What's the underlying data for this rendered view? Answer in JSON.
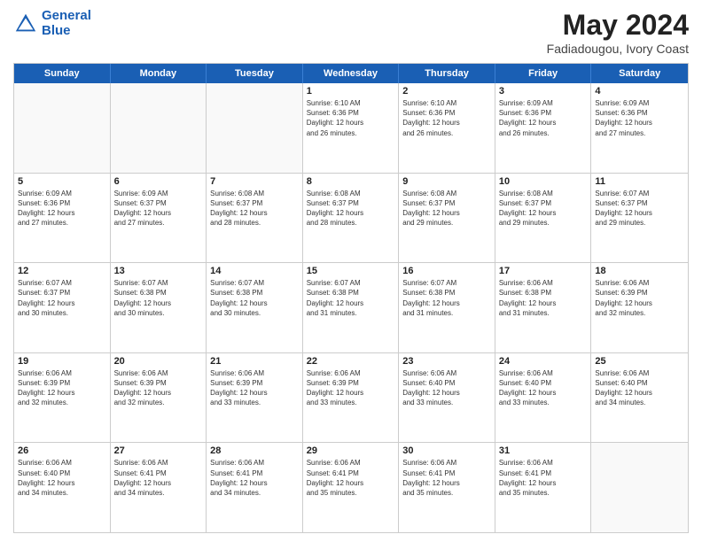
{
  "header": {
    "logo_line1": "General",
    "logo_line2": "Blue",
    "main_title": "May 2024",
    "subtitle": "Fadiadougou, Ivory Coast"
  },
  "weekdays": [
    "Sunday",
    "Monday",
    "Tuesday",
    "Wednesday",
    "Thursday",
    "Friday",
    "Saturday"
  ],
  "rows": [
    [
      {
        "day": "",
        "info": ""
      },
      {
        "day": "",
        "info": ""
      },
      {
        "day": "",
        "info": ""
      },
      {
        "day": "1",
        "info": "Sunrise: 6:10 AM\nSunset: 6:36 PM\nDaylight: 12 hours\nand 26 minutes."
      },
      {
        "day": "2",
        "info": "Sunrise: 6:10 AM\nSunset: 6:36 PM\nDaylight: 12 hours\nand 26 minutes."
      },
      {
        "day": "3",
        "info": "Sunrise: 6:09 AM\nSunset: 6:36 PM\nDaylight: 12 hours\nand 26 minutes."
      },
      {
        "day": "4",
        "info": "Sunrise: 6:09 AM\nSunset: 6:36 PM\nDaylight: 12 hours\nand 27 minutes."
      }
    ],
    [
      {
        "day": "5",
        "info": "Sunrise: 6:09 AM\nSunset: 6:36 PM\nDaylight: 12 hours\nand 27 minutes."
      },
      {
        "day": "6",
        "info": "Sunrise: 6:09 AM\nSunset: 6:37 PM\nDaylight: 12 hours\nand 27 minutes."
      },
      {
        "day": "7",
        "info": "Sunrise: 6:08 AM\nSunset: 6:37 PM\nDaylight: 12 hours\nand 28 minutes."
      },
      {
        "day": "8",
        "info": "Sunrise: 6:08 AM\nSunset: 6:37 PM\nDaylight: 12 hours\nand 28 minutes."
      },
      {
        "day": "9",
        "info": "Sunrise: 6:08 AM\nSunset: 6:37 PM\nDaylight: 12 hours\nand 29 minutes."
      },
      {
        "day": "10",
        "info": "Sunrise: 6:08 AM\nSunset: 6:37 PM\nDaylight: 12 hours\nand 29 minutes."
      },
      {
        "day": "11",
        "info": "Sunrise: 6:07 AM\nSunset: 6:37 PM\nDaylight: 12 hours\nand 29 minutes."
      }
    ],
    [
      {
        "day": "12",
        "info": "Sunrise: 6:07 AM\nSunset: 6:37 PM\nDaylight: 12 hours\nand 30 minutes."
      },
      {
        "day": "13",
        "info": "Sunrise: 6:07 AM\nSunset: 6:38 PM\nDaylight: 12 hours\nand 30 minutes."
      },
      {
        "day": "14",
        "info": "Sunrise: 6:07 AM\nSunset: 6:38 PM\nDaylight: 12 hours\nand 30 minutes."
      },
      {
        "day": "15",
        "info": "Sunrise: 6:07 AM\nSunset: 6:38 PM\nDaylight: 12 hours\nand 31 minutes."
      },
      {
        "day": "16",
        "info": "Sunrise: 6:07 AM\nSunset: 6:38 PM\nDaylight: 12 hours\nand 31 minutes."
      },
      {
        "day": "17",
        "info": "Sunrise: 6:06 AM\nSunset: 6:38 PM\nDaylight: 12 hours\nand 31 minutes."
      },
      {
        "day": "18",
        "info": "Sunrise: 6:06 AM\nSunset: 6:39 PM\nDaylight: 12 hours\nand 32 minutes."
      }
    ],
    [
      {
        "day": "19",
        "info": "Sunrise: 6:06 AM\nSunset: 6:39 PM\nDaylight: 12 hours\nand 32 minutes."
      },
      {
        "day": "20",
        "info": "Sunrise: 6:06 AM\nSunset: 6:39 PM\nDaylight: 12 hours\nand 32 minutes."
      },
      {
        "day": "21",
        "info": "Sunrise: 6:06 AM\nSunset: 6:39 PM\nDaylight: 12 hours\nand 33 minutes."
      },
      {
        "day": "22",
        "info": "Sunrise: 6:06 AM\nSunset: 6:39 PM\nDaylight: 12 hours\nand 33 minutes."
      },
      {
        "day": "23",
        "info": "Sunrise: 6:06 AM\nSunset: 6:40 PM\nDaylight: 12 hours\nand 33 minutes."
      },
      {
        "day": "24",
        "info": "Sunrise: 6:06 AM\nSunset: 6:40 PM\nDaylight: 12 hours\nand 33 minutes."
      },
      {
        "day": "25",
        "info": "Sunrise: 6:06 AM\nSunset: 6:40 PM\nDaylight: 12 hours\nand 34 minutes."
      }
    ],
    [
      {
        "day": "26",
        "info": "Sunrise: 6:06 AM\nSunset: 6:40 PM\nDaylight: 12 hours\nand 34 minutes."
      },
      {
        "day": "27",
        "info": "Sunrise: 6:06 AM\nSunset: 6:41 PM\nDaylight: 12 hours\nand 34 minutes."
      },
      {
        "day": "28",
        "info": "Sunrise: 6:06 AM\nSunset: 6:41 PM\nDaylight: 12 hours\nand 34 minutes."
      },
      {
        "day": "29",
        "info": "Sunrise: 6:06 AM\nSunset: 6:41 PM\nDaylight: 12 hours\nand 35 minutes."
      },
      {
        "day": "30",
        "info": "Sunrise: 6:06 AM\nSunset: 6:41 PM\nDaylight: 12 hours\nand 35 minutes."
      },
      {
        "day": "31",
        "info": "Sunrise: 6:06 AM\nSunset: 6:41 PM\nDaylight: 12 hours\nand 35 minutes."
      },
      {
        "day": "",
        "info": ""
      }
    ]
  ]
}
